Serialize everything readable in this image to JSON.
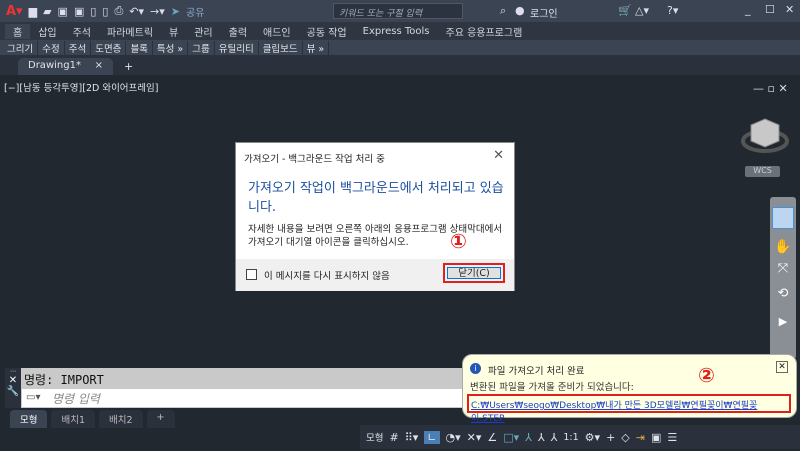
{
  "titlebar": {
    "share": "공유",
    "search_placeholder": "키워드 또는 구절 입력",
    "login": "로그인"
  },
  "ribbon": {
    "tabs": [
      "홈",
      "삽입",
      "주석",
      "파라메트릭",
      "뷰",
      "관리",
      "출력",
      "애드인",
      "공동 작업",
      "Express Tools",
      "주요 응용프로그램"
    ],
    "panels": [
      "그리기",
      "수정",
      "주석",
      "도면층",
      "블록",
      "특성 »",
      "그룹",
      "유틸리티",
      "클립보드",
      "뷰 »"
    ]
  },
  "doc_tab": {
    "label": "Drawing1*",
    "close": "×",
    "add": "+"
  },
  "viewport": {
    "label": "[−][남동 등각투영][2D 와이어프레임]",
    "wcs": "WCS"
  },
  "dialog": {
    "title": "가져오기 - 백그라운드 작업 처리 중",
    "heading": "가져오기 작업이 백그라운드에서 처리되고 있습니다.",
    "body": "자세한 내용을 보려면 오른쪽 아래의 응용프로그램 상태막대에서 가져오기 대기열 아이콘을 클릭하십시오.",
    "checkbox": "이 메시지를 다시 표시하지 않음",
    "close_button": "닫기(C)",
    "annotation": "①"
  },
  "command": {
    "history": "명령: IMPORT",
    "placeholder": "명령 입력"
  },
  "layout_tabs": [
    "모형",
    "배치1",
    "배치2",
    "+"
  ],
  "status": {
    "model": "모형",
    "scale": "1:1"
  },
  "balloon": {
    "title": "파일 가져오기 처리 완료",
    "message": "변환된 파일을 가져올 준비가 되었습니다:",
    "link": "C:₩Users₩seogo₩Desktop₩내가 만든 3D모델링₩연필꽂이₩연필꽂이.STEP",
    "annotation": "②"
  }
}
